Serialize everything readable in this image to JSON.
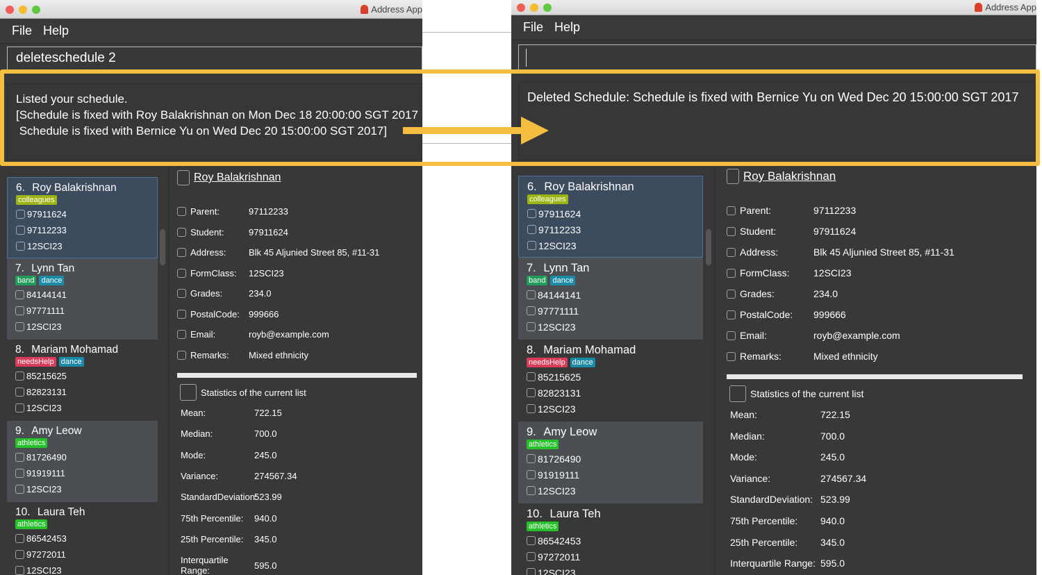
{
  "annotation": {
    "highlight_color": "#F5BE41",
    "arrow": "right-arrow"
  },
  "window": {
    "title": "Address App",
    "menu": [
      "File",
      "Help"
    ],
    "traffic_lights": [
      "#ee5f57",
      "#f5bd2e",
      "#5fc93f"
    ]
  },
  "before": {
    "command_value": "deleteschedule 2",
    "result_text": "Listed your schedule.\n[Schedule is fixed with Roy Balakrishnan on Mon Dec 18 20:00:00 SGT 2017\n Schedule is fixed with Bernice Yu on Wed Dec 20 15:00:00 SGT 2017]"
  },
  "after": {
    "command_value": "",
    "result_text": "Deleted Schedule: Schedule is fixed with Bernice Yu on Wed Dec 20 15:00:00 SGT 2017"
  },
  "tag_colors": {
    "colleagues": "#9cb414",
    "band": "#219c5a",
    "dance": "#1a8aa6",
    "needsHelp": "#d93b5b",
    "athletics": "#27c12c"
  },
  "persons": [
    {
      "index": "6.",
      "name": "Roy Balakrishnan",
      "tags": [
        "colleagues"
      ],
      "student": "97911624",
      "parent": "97112233",
      "formclass": "12SCI23",
      "selected": true
    },
    {
      "index": "7.",
      "name": "Lynn Tan",
      "tags": [
        "band",
        "dance"
      ],
      "student": "84144141",
      "parent": "97771111",
      "formclass": "12SCI23"
    },
    {
      "index": "8.",
      "name": "Mariam Mohamad",
      "tags": [
        "needsHelp",
        "dance"
      ],
      "student": "85215625",
      "parent": "82823131",
      "formclass": "12SCI23"
    },
    {
      "index": "9.",
      "name": "Amy Leow",
      "tags": [
        "athletics"
      ],
      "student": "81726490",
      "parent": "91919111",
      "formclass": "12SCI23"
    },
    {
      "index": "10.",
      "name": "Laura Teh",
      "tags": [
        "athletics"
      ],
      "student": "86542453",
      "parent": "97272011",
      "formclass": "12SCI23"
    }
  ],
  "details": {
    "name": "Roy Balakrishnan",
    "fields": [
      {
        "label": "Parent:",
        "value": "97112233",
        "icon": "parent-icon"
      },
      {
        "label": "Student:",
        "value": "97911624",
        "icon": "student-icon"
      },
      {
        "label": "Address:",
        "value": "Blk 45 Aljunied Street 85, #11-31",
        "icon": "home-icon"
      },
      {
        "label": "FormClass:",
        "value": "12SCI23",
        "icon": "class-icon"
      },
      {
        "label": "Grades:",
        "value": "234.0",
        "icon": "document-icon"
      },
      {
        "label": "PostalCode:",
        "value": "999666",
        "icon": "location-pin-icon"
      },
      {
        "label": "Email:",
        "value": "royb@example.com",
        "icon": "envelope-icon"
      },
      {
        "label": "Remarks:",
        "value": "Mixed ethnicity",
        "icon": "pencil-icon"
      }
    ]
  },
  "statistics": {
    "title": "Statistics of the current list",
    "rows": [
      {
        "label": "Mean:",
        "value": "722.15"
      },
      {
        "label": "Median:",
        "value": "700.0"
      },
      {
        "label": "Mode:",
        "value": "245.0"
      },
      {
        "label": "Variance:",
        "value": "274567.34"
      },
      {
        "label": "StandardDeviation:",
        "value": "523.99"
      },
      {
        "label": "75th Percentile:",
        "value": "940.0"
      },
      {
        "label": "25th Percentile:",
        "value": "345.0"
      },
      {
        "label": "Interquartile Range:",
        "value": "595.0"
      }
    ]
  }
}
